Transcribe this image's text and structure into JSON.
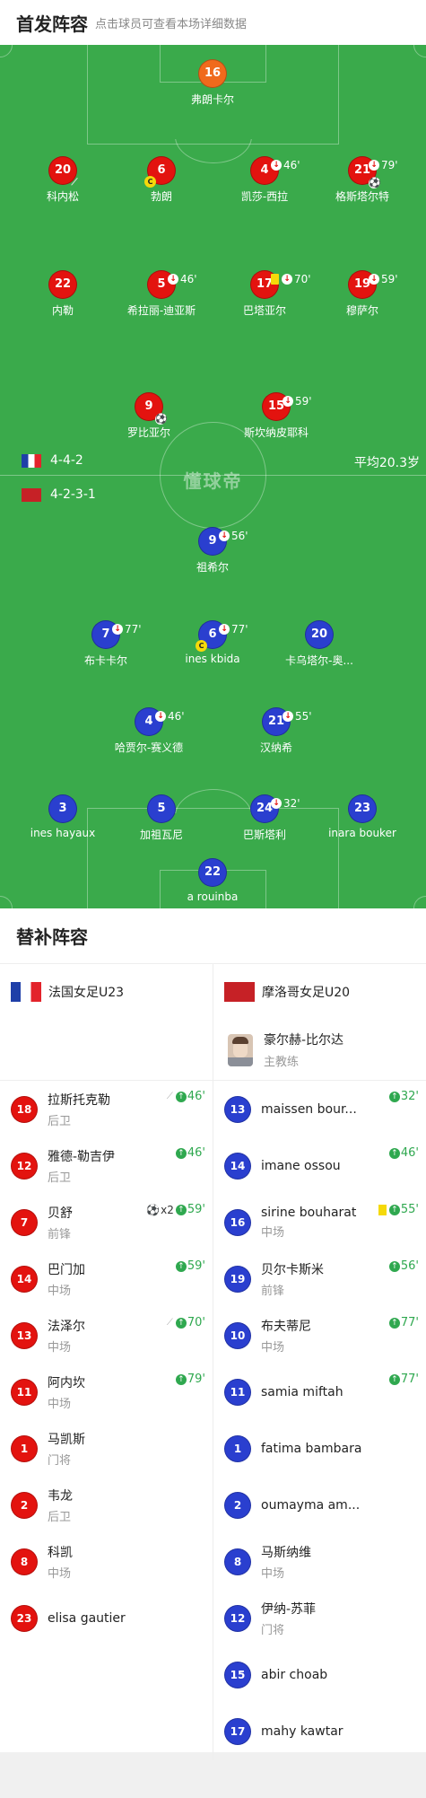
{
  "header": {
    "title": "首发阵容",
    "hint": "点击球员可查看本场详细数据"
  },
  "watermark": "懂球帝",
  "france": {
    "formation": "4-4-2",
    "flag_colors": [
      "#1f3fa8",
      "#ffffff",
      "#e3232b"
    ]
  },
  "morocco": {
    "formation": "4-2-3-1",
    "flag_colors": [
      "#c62126",
      "#0f7a35"
    ]
  },
  "avg_age": "平均20.3岁",
  "pitch_players": [
    {
      "id": "gk_f",
      "num": "16",
      "name": "弗朗卡尔",
      "color": "orange"
    },
    {
      "id": "d1",
      "num": "20",
      "name": "科内松",
      "color": "red",
      "boot": true
    },
    {
      "id": "d2",
      "num": "6",
      "name": "勃朗",
      "color": "red",
      "captain": "C"
    },
    {
      "id": "d3",
      "num": "4",
      "name": "凯莎-西拉",
      "color": "red",
      "sub": "46'"
    },
    {
      "id": "d4",
      "num": "21",
      "name": "格斯塔尔特",
      "color": "red",
      "sub": "79'",
      "ball": true
    },
    {
      "id": "m1",
      "num": "22",
      "name": "内勒",
      "color": "red"
    },
    {
      "id": "m2",
      "num": "5",
      "name": "希拉丽-迪亚斯",
      "color": "red",
      "sub": "46'"
    },
    {
      "id": "m3",
      "num": "17",
      "name": "巴塔亚尔",
      "color": "red",
      "sub": "70'",
      "yellow": true
    },
    {
      "id": "m4",
      "num": "19",
      "name": "穆萨尔",
      "color": "red",
      "sub": "59'"
    },
    {
      "id": "f1",
      "num": "9",
      "name": "罗比亚尔",
      "color": "red",
      "ball": true
    },
    {
      "id": "f2",
      "num": "15",
      "name": "斯坎纳皮耶科",
      "color": "red",
      "sub": "59'"
    },
    {
      "id": "mf1",
      "num": "9",
      "name": "祖希尔",
      "color": "blue",
      "sub": "56'"
    },
    {
      "id": "mm1",
      "num": "7",
      "name": "布卡卡尔",
      "color": "blue",
      "sub": "77'"
    },
    {
      "id": "mm2",
      "num": "6",
      "name": "ines kbida",
      "color": "blue",
      "sub": "77'",
      "captain": "C"
    },
    {
      "id": "mm3",
      "num": "20",
      "name": "卡乌塔尔-奥...",
      "color": "blue"
    },
    {
      "id": "md1",
      "num": "4",
      "name": "哈贾尔-赛义德",
      "color": "blue",
      "sub": "46'"
    },
    {
      "id": "md2",
      "num": "21",
      "name": "汉纳希",
      "color": "blue",
      "sub": "55'"
    },
    {
      "id": "mb1",
      "num": "3",
      "name": "ines hayaux",
      "color": "blue"
    },
    {
      "id": "mb2",
      "num": "5",
      "name": "加祖瓦尼",
      "color": "blue"
    },
    {
      "id": "mb3",
      "num": "24",
      "name": "巴斯塔利",
      "color": "blue",
      "sub": "32'"
    },
    {
      "id": "mb4",
      "num": "23",
      "name": "inara bouker",
      "color": "blue"
    },
    {
      "id": "gk_m",
      "num": "22",
      "name": "a rouinba",
      "color": "blue"
    }
  ],
  "subs": {
    "title": "替补阵容",
    "left_team": "法国女足U23",
    "right_team": "摩洛哥女足U20",
    "coach": {
      "name": "豪尔赫-比尔达",
      "role": "主教练"
    },
    "left": [
      {
        "num": "18",
        "name": "拉斯托克勒",
        "pos": "后卫",
        "boot": true,
        "min": "46'"
      },
      {
        "num": "12",
        "name": "雅德-勒吉伊",
        "pos": "后卫",
        "min": "46'"
      },
      {
        "num": "7",
        "name": "贝舒",
        "pos": "前锋",
        "ball": "x2",
        "min": "59'"
      },
      {
        "num": "14",
        "name": "巴门加",
        "pos": "中场",
        "min": "59'"
      },
      {
        "num": "13",
        "name": "法泽尔",
        "pos": "中场",
        "boot": true,
        "min": "70'"
      },
      {
        "num": "11",
        "name": "阿内坎",
        "pos": "中场",
        "min": "79'"
      },
      {
        "num": "1",
        "name": "马凯斯",
        "pos": "门将"
      },
      {
        "num": "2",
        "name": "韦龙",
        "pos": "后卫"
      },
      {
        "num": "8",
        "name": "科凯",
        "pos": "中场"
      },
      {
        "num": "23",
        "name": "elisa gautier",
        "pos": ""
      }
    ],
    "right": [
      {
        "num": "13",
        "name": "maissen bour...",
        "pos": "",
        "min": "32'"
      },
      {
        "num": "14",
        "name": "imane ossou",
        "pos": "",
        "min": "46'"
      },
      {
        "num": "16",
        "name": "sirine bouharat",
        "pos": "中场",
        "yellow": true,
        "min": "55'"
      },
      {
        "num": "19",
        "name": "贝尔卡斯米",
        "pos": "前锋",
        "min": "56'"
      },
      {
        "num": "10",
        "name": "布夫蒂尼",
        "pos": "中场",
        "min": "77'"
      },
      {
        "num": "11",
        "name": "samia miftah",
        "pos": "",
        "min": "77'"
      },
      {
        "num": "1",
        "name": "fatima bambara",
        "pos": ""
      },
      {
        "num": "2",
        "name": "oumayma am...",
        "pos": ""
      },
      {
        "num": "8",
        "name": "马斯纳维",
        "pos": "中场"
      },
      {
        "num": "12",
        "name": "伊纳-苏菲",
        "pos": "门将"
      },
      {
        "num": "15",
        "name": "abir choab",
        "pos": ""
      },
      {
        "num": "17",
        "name": "mahy kawtar",
        "pos": ""
      }
    ]
  }
}
